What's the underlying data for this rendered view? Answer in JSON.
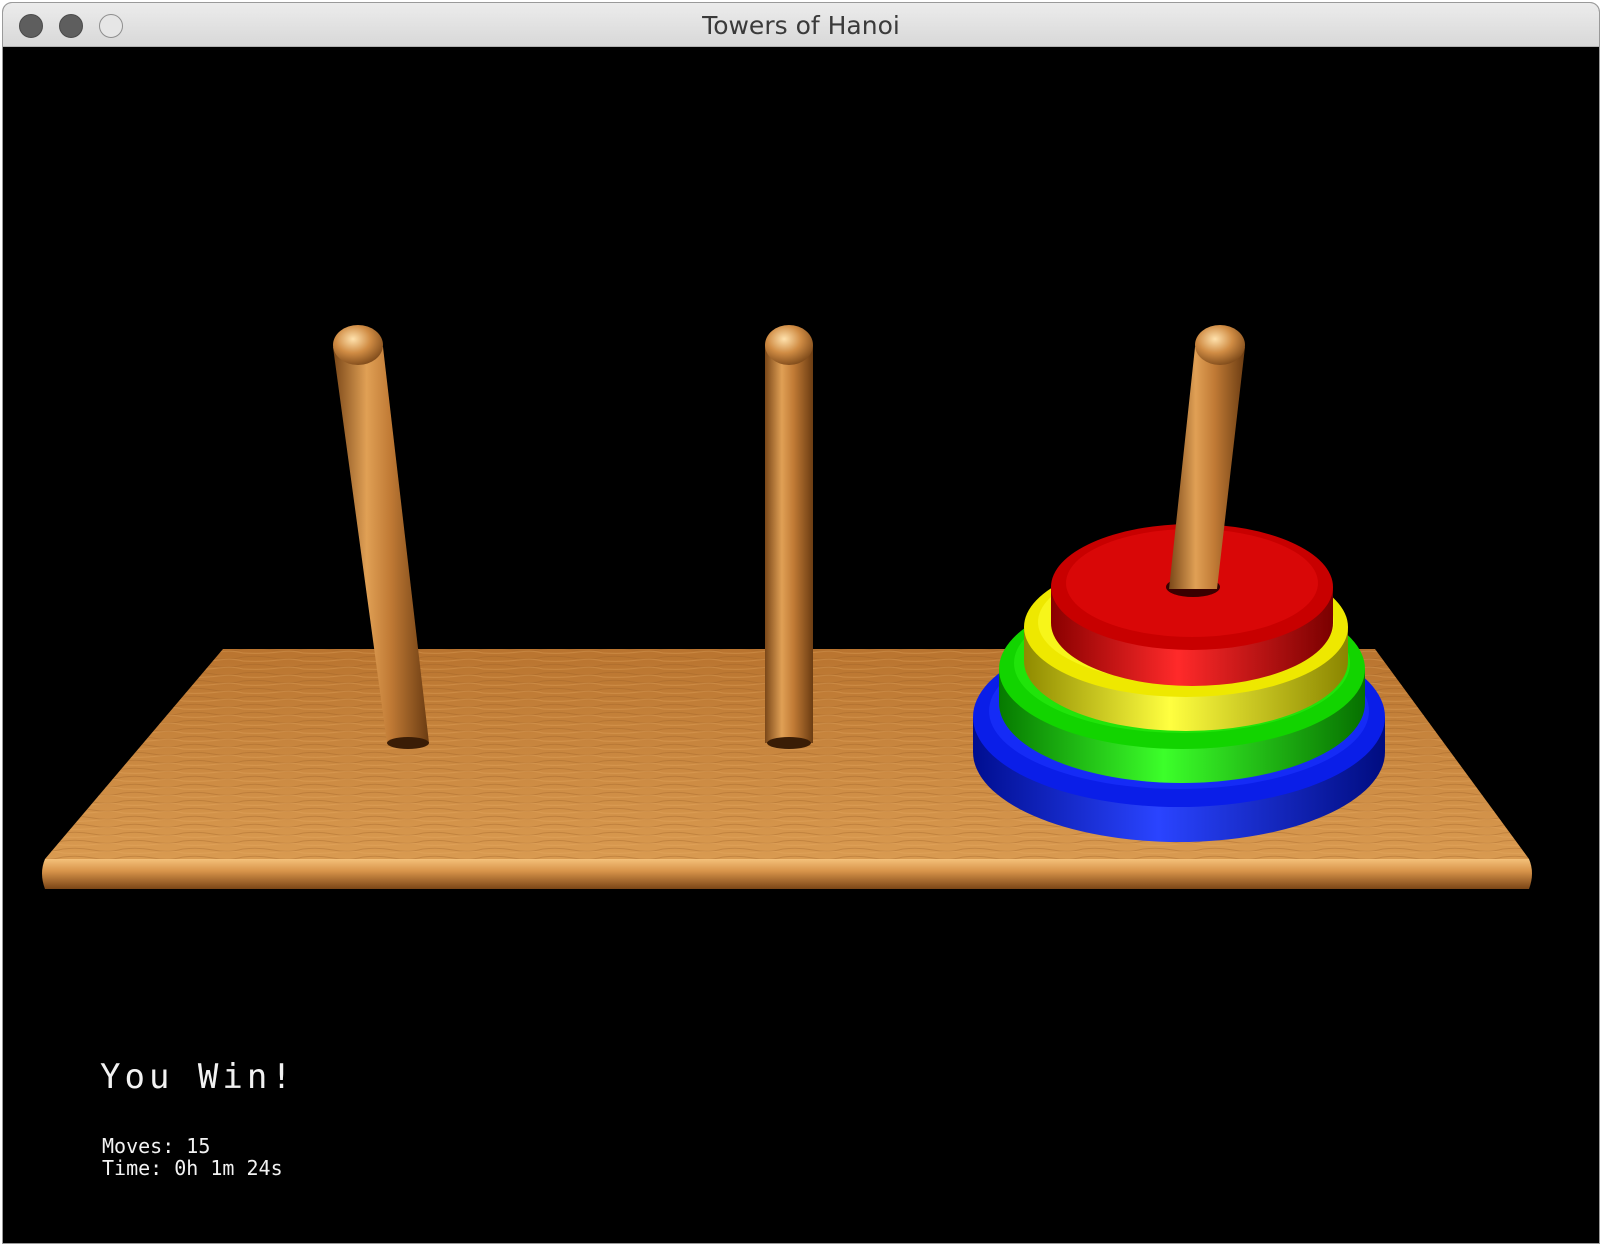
{
  "window": {
    "title": "Towers of Hanoi"
  },
  "game": {
    "rods": [
      "left",
      "middle",
      "right"
    ],
    "disks": [
      {
        "size": 1,
        "rod": "right",
        "color": "#d10000",
        "name": "red"
      },
      {
        "size": 2,
        "rod": "right",
        "color": "#e6e000",
        "name": "yellow"
      },
      {
        "size": 3,
        "rod": "right",
        "color": "#0ccc00",
        "name": "green"
      },
      {
        "size": 4,
        "rod": "right",
        "color": "#0018e0",
        "name": "blue"
      }
    ],
    "board_color": "#c98540"
  },
  "hud": {
    "status": "You Win!",
    "moves_line": "Moves: 15",
    "time_line": "Time: 0h 1m 24s"
  }
}
